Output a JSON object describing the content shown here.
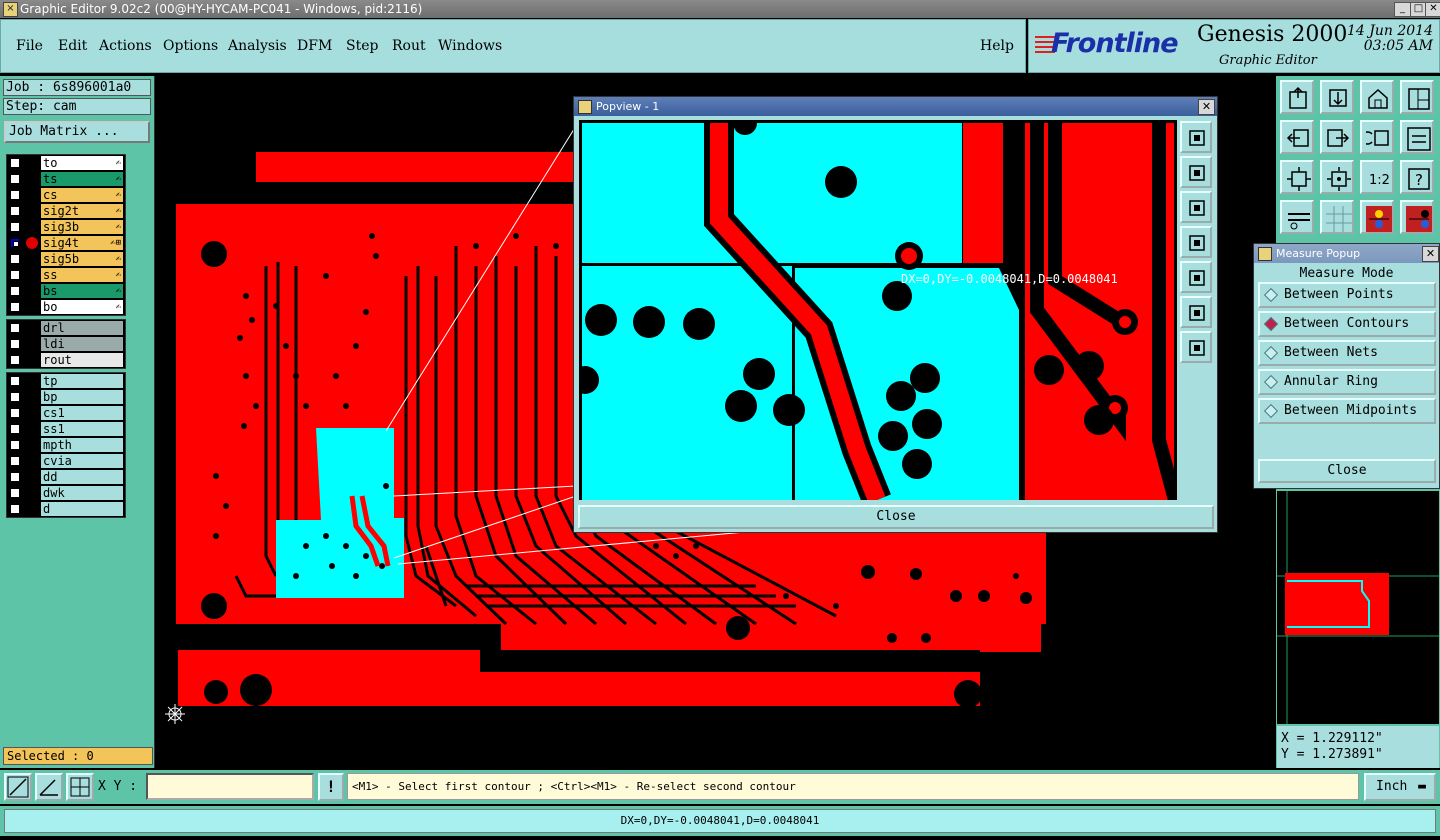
{
  "window": {
    "title": "Graphic Editor 9.02c2 (00@HY-HYCAM-PC041 - Windows, pid:2116)",
    "btn_min": "_",
    "btn_max": "□",
    "btn_close": "✕"
  },
  "menu": {
    "file": "File",
    "edit": "Edit",
    "actions": "Actions",
    "options": "Options",
    "analysis": "Analysis",
    "dfm": "DFM",
    "step": "Step",
    "rout": "Rout",
    "windows": "Windows",
    "help": "Help"
  },
  "logo": {
    "brand": "Frontline",
    "product": "Genesis 2000",
    "subtitle": "Graphic Editor",
    "date": "14 Jun 2014",
    "time": "03:05 AM"
  },
  "job": {
    "job_label": "Job : 6s896001a0",
    "step_label": "Step: cam",
    "matrix_button": "Job Matrix ..."
  },
  "layers_board": [
    {
      "name": "to",
      "color": "#ffffff",
      "mark": "✍"
    },
    {
      "name": "ts",
      "color": "#1a9a6a",
      "mark": "✍"
    },
    {
      "name": "cs",
      "color": "#f3c45a",
      "mark": "✍"
    },
    {
      "name": "sig2t",
      "color": "#f3c45a",
      "mark": "✍"
    },
    {
      "name": "sig3b",
      "color": "#f3c45a",
      "mark": "✍"
    },
    {
      "name": "sig4t",
      "color": "#f3c45a",
      "mark": "✍⊞",
      "active": true
    },
    {
      "name": "sig5b",
      "color": "#f3c45a",
      "mark": "✍"
    },
    {
      "name": "ss",
      "color": "#f3c45a",
      "mark": "✍"
    },
    {
      "name": "bs",
      "color": "#1a9a6a",
      "mark": "✍"
    },
    {
      "name": "bo",
      "color": "#ffffff",
      "mark": "✍"
    }
  ],
  "layers_drill": [
    {
      "name": "drl",
      "color": "#9aaaa8"
    },
    {
      "name": "ldi",
      "color": "#9aaaa8"
    },
    {
      "name": "rout",
      "color": "#e8e8e8"
    }
  ],
  "layers_misc": [
    {
      "name": "tp",
      "color": "#a8dede"
    },
    {
      "name": "bp",
      "color": "#a8dede"
    },
    {
      "name": "cs1",
      "color": "#a8dede"
    },
    {
      "name": "ss1",
      "color": "#a8dede"
    },
    {
      "name": "mpth",
      "color": "#a8dede"
    },
    {
      "name": "cvia",
      "color": "#a8dede"
    },
    {
      "name": "dd",
      "color": "#a8dede"
    },
    {
      "name": "dwk",
      "color": "#a8dede"
    },
    {
      "name": "d",
      "color": "#a8dede"
    }
  ],
  "selected": "Selected : 0",
  "popview": {
    "title": "Popview - 1",
    "close": "Close",
    "measure_readout": "DX=0,DY=-0.0048041,D=0.0048041"
  },
  "measure": {
    "title": "Measure Popup",
    "mode_label": "Measure Mode",
    "options": [
      "Between Points",
      "Between Contours",
      "Between Nets",
      "Annular Ring",
      "Between Midpoints"
    ],
    "selected_option": "Between Contours",
    "close": "Close"
  },
  "coords": {
    "x": "X = 1.229112\"",
    "y": "Y = 1.273891\""
  },
  "toolbar_buttons": [
    "zoom-home-icon",
    "zoom-in-icon",
    "home-icon",
    "split-view-icon",
    "pan-left-icon",
    "pan-right-icon",
    "redraw-icon",
    "swap-icon",
    "fit-icon",
    "center-icon",
    "one-to-two-icon",
    "help-icon",
    "measure-tool-icon",
    "grid-icon",
    "layer-color-icon",
    "layer-color-alt-icon"
  ],
  "bottom": {
    "xy_label": "X Y :",
    "xy_value": "",
    "prompt": "<M1> - Select first contour ; <Ctrl><M1> - Re-select second contour",
    "unit": "Inch",
    "bang": "!"
  },
  "status": "DX=0,DY=-0.0048041,D=0.0048041",
  "colors": {
    "panel": "#5ec4a8",
    "button": "#a8dede",
    "copper": "#ff0000",
    "selection": "#00ffff"
  }
}
